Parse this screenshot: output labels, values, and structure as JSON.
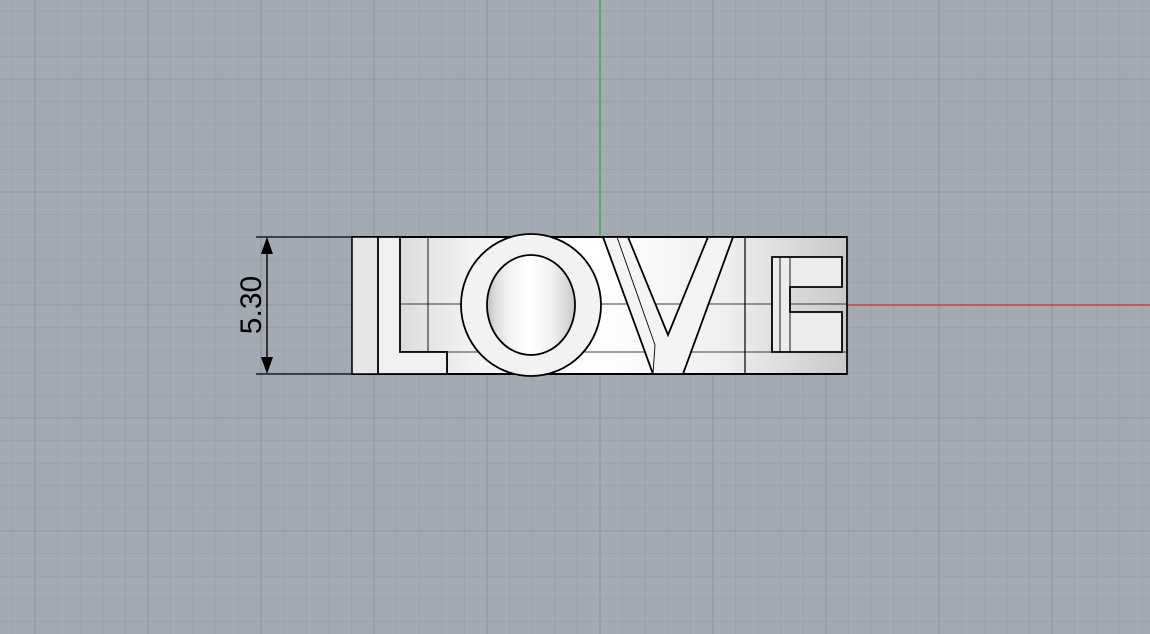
{
  "viewport": {
    "background_color": "#a3aab2",
    "minor_grid_color": "#9aa1a9",
    "major_grid_color": "#8e959d",
    "x_axis_color": "#b23a35",
    "y_axis_color": "#3aa640"
  },
  "model": {
    "text": "LOVE",
    "surface_color": "#e8e8e8",
    "edge_color": "#000000"
  },
  "dimension": {
    "value": "5.30"
  }
}
